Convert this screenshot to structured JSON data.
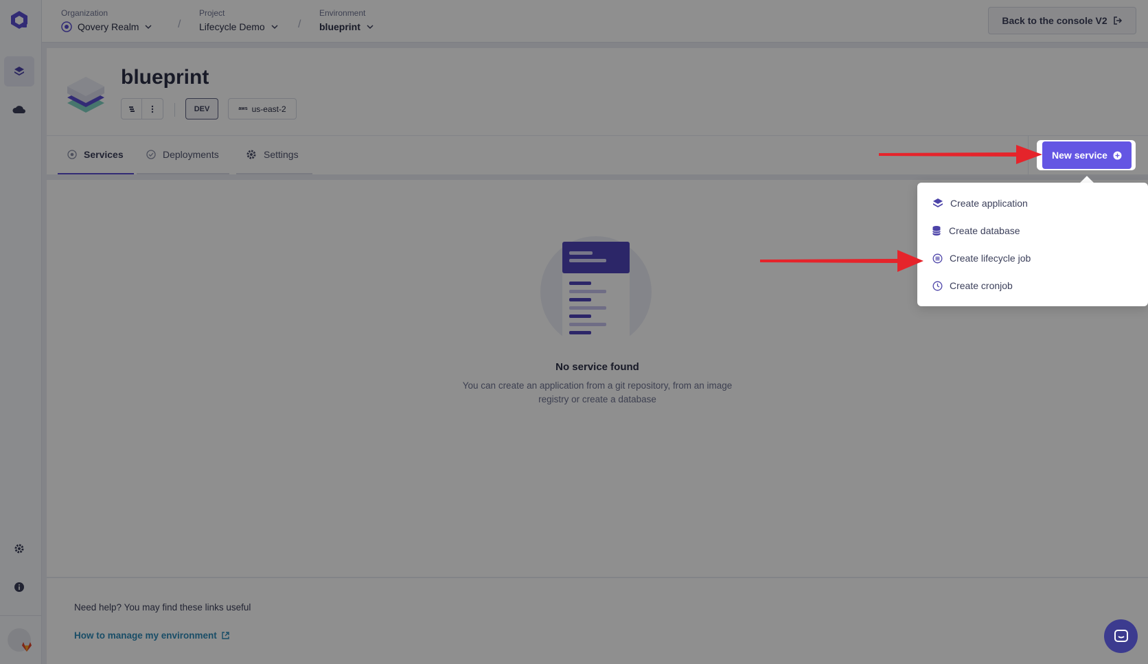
{
  "topbar": {
    "organization": {
      "label": "Organization",
      "value": "Qovery Realm"
    },
    "project": {
      "label": "Project",
      "value": "Lifecycle Demo"
    },
    "environment": {
      "label": "Environment",
      "value": "blueprint"
    },
    "separator": "/",
    "back_button": "Back to the console V2"
  },
  "header": {
    "title": "blueprint",
    "mode_badge": "DEV",
    "provider_logo": "aws",
    "region": "us-east-2"
  },
  "tabs": [
    {
      "label": "Services",
      "icon": "services-icon",
      "active": true
    },
    {
      "label": "Deployments",
      "icon": "deployments-icon",
      "active": false
    },
    {
      "label": "Settings",
      "icon": "gear-icon",
      "active": false
    }
  ],
  "new_service_button": "New service",
  "dropdown": {
    "items": [
      {
        "label": "Create application",
        "icon": "layers-icon"
      },
      {
        "label": "Create database",
        "icon": "database-icon"
      },
      {
        "label": "Create lifecycle job",
        "icon": "lifecycle-icon",
        "highlighted": true
      },
      {
        "label": "Create cronjob",
        "icon": "clock-icon"
      }
    ]
  },
  "empty_state": {
    "title": "No service found",
    "description": "You can create an application from a git repository, from an image registry or create a database"
  },
  "footer": {
    "help_text": "Need help? You may find these links useful",
    "link": "How to manage my environment"
  },
  "colors": {
    "accent": "#6456e3",
    "annotation_arrow": "#e5242b"
  }
}
